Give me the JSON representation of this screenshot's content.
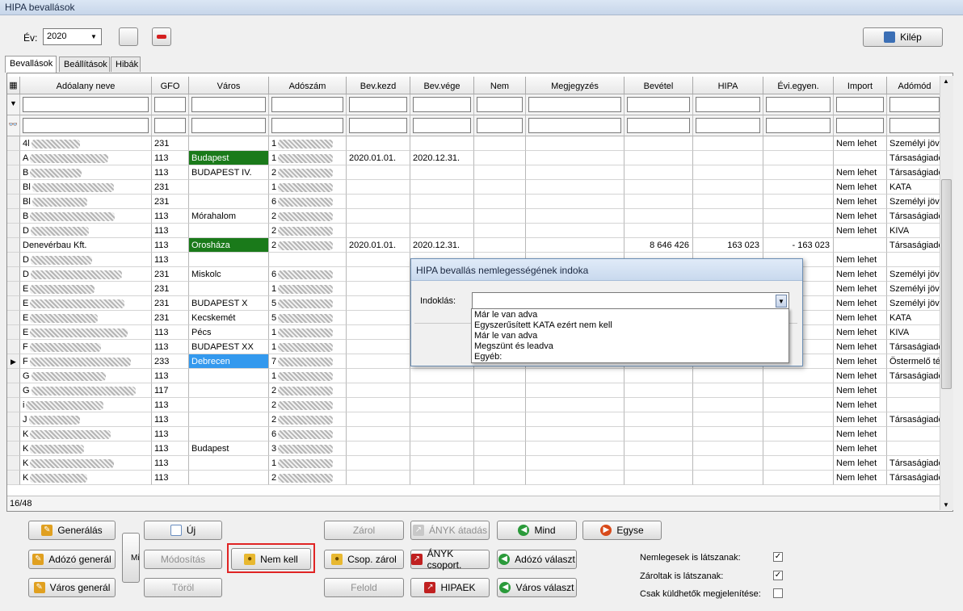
{
  "window": {
    "title": "HIPA bevallások"
  },
  "toolbar": {
    "year_label": "Év:",
    "year_value": "2020",
    "exit_label": "Kilép"
  },
  "tabs": [
    "Bevallások",
    "Beállítások",
    "Hibák"
  ],
  "columns": [
    "Adóalany neve",
    "GFO",
    "Város",
    "Adószám",
    "Bev.kezd",
    "Bev.vége",
    "Nem",
    "Megjegyzés",
    "Bevétel",
    "HIPA",
    "Évi.egyen.",
    "Import",
    "Adómód"
  ],
  "rows": [
    {
      "name": "4l",
      "gfo": "231",
      "city": "",
      "city_color": "",
      "tax": "1",
      "start": "",
      "end": "",
      "nem": "",
      "note": "",
      "rev": "",
      "hipa": "",
      "evi": "",
      "import": "Nem lehet",
      "mode": "Személyi jöve",
      "current": false
    },
    {
      "name": "A",
      "gfo": "113",
      "city": "Budapest",
      "city_color": "#1a7a1a",
      "tax": "1",
      "start": "2020.01.01.",
      "end": "2020.12.31.",
      "nem": "",
      "note": "",
      "rev": "",
      "hipa": "",
      "evi": "",
      "import": "",
      "mode": "Társaságiadó",
      "current": false
    },
    {
      "name": "B",
      "gfo": "113",
      "city": "BUDAPEST IV.",
      "city_color": "",
      "tax": "2",
      "start": "",
      "end": "",
      "nem": "",
      "note": "",
      "rev": "",
      "hipa": "",
      "evi": "",
      "import": "Nem lehet",
      "mode": "Társaságiadó",
      "current": false
    },
    {
      "name": "Bl",
      "gfo": "231",
      "city": "",
      "city_color": "",
      "tax": "1",
      "start": "",
      "end": "",
      "nem": "",
      "note": "",
      "rev": "",
      "hipa": "",
      "evi": "",
      "import": "Nem lehet",
      "mode": "KATA",
      "current": false
    },
    {
      "name": "Bl",
      "gfo": "231",
      "city": "",
      "city_color": "",
      "tax": "6",
      "start": "",
      "end": "",
      "nem": "",
      "note": "",
      "rev": "",
      "hipa": "",
      "evi": "",
      "import": "Nem lehet",
      "mode": "Személyi jöve",
      "current": false
    },
    {
      "name": "B",
      "gfo": "113",
      "city": "Mórahalom",
      "city_color": "",
      "tax": "2",
      "start": "",
      "end": "",
      "nem": "",
      "note": "",
      "rev": "",
      "hipa": "",
      "evi": "",
      "import": "Nem lehet",
      "mode": "Társaságiadó",
      "current": false
    },
    {
      "name": "D",
      "gfo": "113",
      "city": "",
      "city_color": "",
      "tax": "2",
      "start": "",
      "end": "",
      "nem": "",
      "note": "",
      "rev": "",
      "hipa": "",
      "evi": "",
      "import": "Nem lehet",
      "mode": "KIVA",
      "current": false
    },
    {
      "name": "Denevérbau Kft.",
      "gfo": "113",
      "city": "Orosháza",
      "city_color": "#1a7a1a",
      "tax": "2",
      "start": "2020.01.01.",
      "end": "2020.12.31.",
      "nem": "",
      "note": "",
      "rev": "8 646 426",
      "hipa": "163 023",
      "evi": "- 163 023",
      "import": "",
      "mode": "Társaságiadó",
      "current": false
    },
    {
      "name": "D",
      "gfo": "113",
      "city": "",
      "city_color": "",
      "tax": "",
      "start": "",
      "end": "",
      "nem": "",
      "note": "",
      "rev": "",
      "hipa": "",
      "evi": "",
      "import": "Nem lehet",
      "mode": "",
      "current": false
    },
    {
      "name": "D",
      "gfo": "231",
      "city": "Miskolc",
      "city_color": "",
      "tax": "6",
      "start": "",
      "end": "",
      "nem": "",
      "note": "",
      "rev": "",
      "hipa": "",
      "evi": "",
      "import": "Nem lehet",
      "mode": "Személyi jöve",
      "current": false
    },
    {
      "name": "E",
      "gfo": "231",
      "city": "",
      "city_color": "",
      "tax": "1",
      "start": "",
      "end": "",
      "nem": "",
      "note": "",
      "rev": "",
      "hipa": "",
      "evi": "",
      "import": "Nem lehet",
      "mode": "Személyi jöve",
      "current": false
    },
    {
      "name": "E",
      "gfo": "231",
      "city": "BUDAPEST X",
      "city_color": "",
      "tax": "5",
      "start": "",
      "end": "",
      "nem": "",
      "note": "",
      "rev": "",
      "hipa": "",
      "evi": "",
      "import": "Nem lehet",
      "mode": "Személyi jöve",
      "current": false
    },
    {
      "name": "E",
      "gfo": "231",
      "city": "Kecskemét",
      "city_color": "",
      "tax": "5",
      "start": "",
      "end": "",
      "nem": "",
      "note": "",
      "rev": "",
      "hipa": "",
      "evi": "",
      "import": "Nem lehet",
      "mode": "KATA",
      "current": false
    },
    {
      "name": "E",
      "gfo": "113",
      "city": "Pécs",
      "city_color": "",
      "tax": "1",
      "start": "",
      "end": "",
      "nem": "",
      "note": "",
      "rev": "",
      "hipa": "",
      "evi": "",
      "import": "Nem lehet",
      "mode": "KIVA",
      "current": false
    },
    {
      "name": "F",
      "gfo": "113",
      "city": "BUDAPEST XX",
      "city_color": "",
      "tax": "1",
      "start": "",
      "end": "",
      "nem": "",
      "note": "",
      "rev": "",
      "hipa": "",
      "evi": "",
      "import": "Nem lehet",
      "mode": "Társaságiadó",
      "current": false
    },
    {
      "name": "F",
      "gfo": "233",
      "city": "Debrecen",
      "city_color": "#3399ee",
      "tax": "7",
      "start": "",
      "end": "",
      "nem": "",
      "note": "",
      "rev": "",
      "hipa": "",
      "evi": "",
      "import": "Nem lehet",
      "mode": "Östermelő téte",
      "current": true
    },
    {
      "name": "G",
      "gfo": "113",
      "city": "",
      "city_color": "",
      "tax": "1",
      "start": "",
      "end": "",
      "nem": "",
      "note": "",
      "rev": "",
      "hipa": "",
      "evi": "",
      "import": "Nem lehet",
      "mode": "Társaságiadó",
      "current": false
    },
    {
      "name": "G",
      "gfo": "117",
      "city": "",
      "city_color": "",
      "tax": "2",
      "start": "",
      "end": "",
      "nem": "",
      "note": "",
      "rev": "",
      "hipa": "",
      "evi": "",
      "import": "Nem lehet",
      "mode": "",
      "current": false
    },
    {
      "name": "i",
      "gfo": "113",
      "city": "",
      "city_color": "",
      "tax": "2",
      "start": "",
      "end": "",
      "nem": "",
      "note": "",
      "rev": "",
      "hipa": "",
      "evi": "",
      "import": "Nem lehet",
      "mode": "",
      "current": false
    },
    {
      "name": "J",
      "gfo": "113",
      "city": "",
      "city_color": "",
      "tax": "2",
      "start": "",
      "end": "",
      "nem": "",
      "note": "",
      "rev": "",
      "hipa": "",
      "evi": "",
      "import": "Nem lehet",
      "mode": "Társaságiadó",
      "current": false
    },
    {
      "name": "K",
      "gfo": "113",
      "city": "",
      "city_color": "",
      "tax": "6",
      "start": "",
      "end": "",
      "nem": "",
      "note": "",
      "rev": "",
      "hipa": "",
      "evi": "",
      "import": "Nem lehet",
      "mode": "",
      "current": false
    },
    {
      "name": "K",
      "gfo": "113",
      "city": "Budapest",
      "city_color": "",
      "tax": "3",
      "start": "",
      "end": "",
      "nem": "",
      "note": "",
      "rev": "",
      "hipa": "",
      "evi": "",
      "import": "Nem lehet",
      "mode": "",
      "current": false
    },
    {
      "name": "K",
      "gfo": "113",
      "city": "",
      "city_color": "",
      "tax": "1",
      "start": "",
      "end": "",
      "nem": "",
      "note": "",
      "rev": "",
      "hipa": "",
      "evi": "",
      "import": "Nem lehet",
      "mode": "Társaságiadó",
      "current": false
    },
    {
      "name": "K",
      "gfo": "113",
      "city": "",
      "city_color": "",
      "tax": "2",
      "start": "",
      "end": "",
      "nem": "",
      "note": "",
      "rev": "",
      "hipa": "",
      "evi": "",
      "import": "Nem lehet",
      "mode": "Társaságiadó",
      "current": false
    }
  ],
  "status": {
    "count": "16/48"
  },
  "modal": {
    "title": "HIPA bevallás nemlegességének indoka",
    "field_label": "Indoklás:",
    "field_value": "",
    "options": [
      "Már le van adva",
      "Egyszerűsített KATA ezért nem kell",
      "Már le van adva",
      "Megszünt és leadva",
      "Egyéb:"
    ]
  },
  "buttons": {
    "generalas": "Generálás",
    "adozo_general": "Adózó generál",
    "varos_general": "Város generál",
    "mi": "Mi",
    "uj": "Új",
    "modositas": "Módosítás",
    "torol": "Töröl",
    "nem_kell": "Nem kell",
    "zarol": "Zárol",
    "csop_zarol": "Csop. zárol",
    "felold": "Felold",
    "anyk_atadas": "ÁNYK átadás",
    "anyk_csoport": "ÁNYK csoport.",
    "hipaek": "HIPAEK",
    "mind": "Mind",
    "adozo_valaszt": "Adózó választ",
    "varos_valaszt": "Város választ",
    "egyse": "Egyse"
  },
  "options": {
    "nemlegesek_label": "Nemlegesek is látszanak:",
    "nemlegesek_checked": true,
    "zaroltak_label": "Zároltak is látszanak:",
    "zaroltak_checked": true,
    "csak_label": "Csak küldhetők megjelenítése:",
    "csak_checked": false
  }
}
